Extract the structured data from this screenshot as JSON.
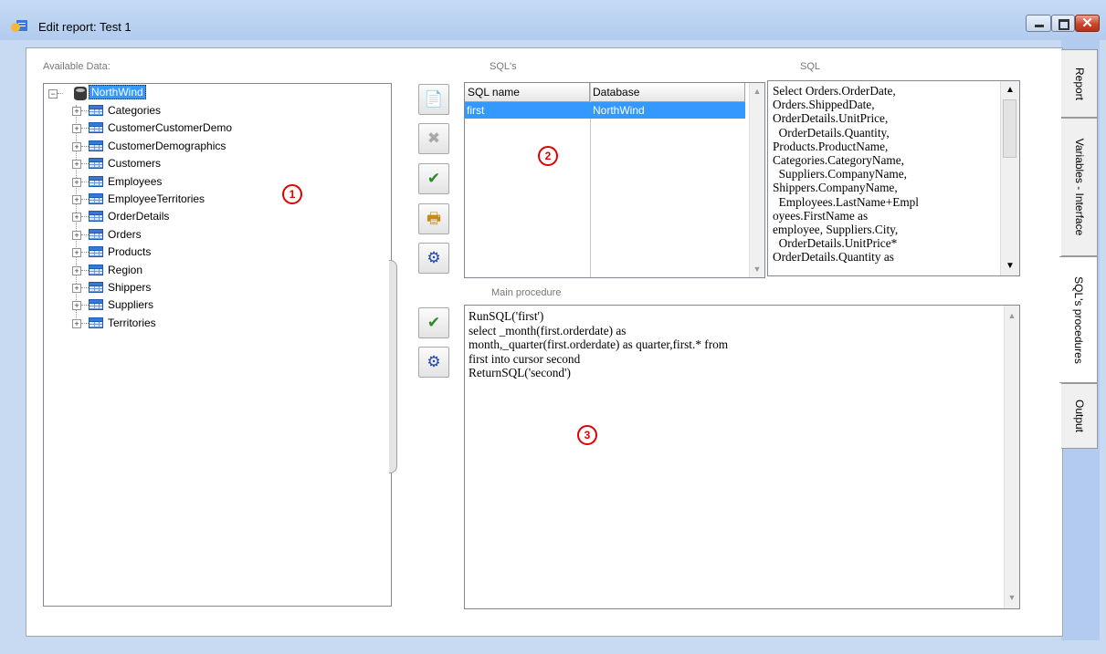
{
  "window": {
    "title": "Edit report: Test 1",
    "min_icon": "minimize-icon",
    "max_icon": "maximize-icon",
    "close_icon": "close-icon",
    "close_glyph": "✕"
  },
  "tabs": [
    {
      "label": "Report"
    },
    {
      "label": "Variables - Interface"
    },
    {
      "label": "SQL's procedures"
    },
    {
      "label": "Output"
    }
  ],
  "available_data": {
    "label": "Available Data:",
    "root": "NorthWind",
    "tables": [
      "Categories",
      "CustomerCustomerDemo",
      "CustomerDemographics",
      "Customers",
      "Employees",
      "EmployeeTerritories",
      "OrderDetails",
      "Orders",
      "Products",
      "Region",
      "Shippers",
      "Suppliers",
      "Territories"
    ]
  },
  "sqls": {
    "label": "SQL's",
    "columns": [
      "SQL name",
      "Database"
    ],
    "rows": [
      {
        "name": "first",
        "database": "NorthWind"
      }
    ]
  },
  "sql": {
    "label": "SQL",
    "text": "Select Orders.OrderDate,\nOrders.ShippedDate,\nOrderDetails.UnitPrice,\n  OrderDetails.Quantity,\nProducts.ProductName,\nCategories.CategoryName,\n  Suppliers.CompanyName,\nShippers.CompanyName,\n  Employees.LastName+Empl\noyees.FirstName as\nemployee, Suppliers.City,\n  OrderDetails.UnitPrice*\nOrderDetails.Quantity as"
  },
  "main_procedure": {
    "label": "Main procedure",
    "text": "RunSQL('first')\nselect _month(first.orderdate) as\nmonth,_quarter(first.orderdate) as quarter,first.* from\nfirst into cursor second\nReturnSQL('second')"
  },
  "toolbar_sqls": [
    {
      "icon": "new-sql-icon",
      "glyph": "📄"
    },
    {
      "icon": "delete-icon",
      "glyph": "✖"
    },
    {
      "icon": "check-icon",
      "glyph": "✔"
    },
    {
      "icon": "print-preview-icon",
      "glyph": "🖶"
    },
    {
      "icon": "run-icon",
      "glyph": "⚙"
    }
  ],
  "toolbar_proc": [
    {
      "icon": "check-icon",
      "glyph": "✔"
    },
    {
      "icon": "run-icon",
      "glyph": "⚙"
    }
  ],
  "markers": [
    "1",
    "2",
    "3"
  ],
  "colors": {
    "selection": "#3399ff",
    "marker": "#e00000"
  }
}
